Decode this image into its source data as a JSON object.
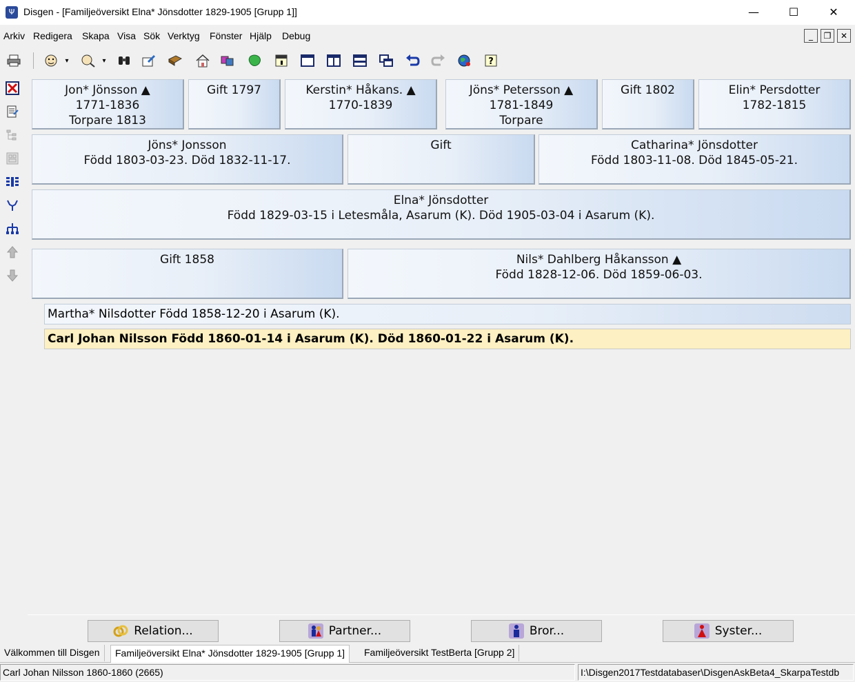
{
  "window": {
    "app_icon_glyph": "Ψ",
    "title": "Disgen - [Familjeöversikt Elna* Jönsdotter 1829-1905 [Grupp 1]]",
    "minimize": "—",
    "maximize": "☐",
    "close": "✕"
  },
  "menu": {
    "items": [
      "Arkiv",
      "Redigera",
      "Skapa",
      "Visa",
      "Sök",
      "Verktyg",
      "Fönster",
      "Hjälp",
      "Debug"
    ],
    "mdi_min": "_",
    "mdi_restore": "❐",
    "mdi_close": "✕"
  },
  "toolbar": {
    "icons": [
      "printer-icon",
      "person-icon",
      "person-search-icon",
      "binoculars-icon",
      "edit-icon",
      "book-icon",
      "home-icon",
      "dice-icon",
      "map-icon",
      "calendar-icon",
      "window-single-icon",
      "window-split-vertical-icon",
      "window-split-horizontal-icon",
      "window-cascade-icon",
      "undo-icon",
      "redo-icon",
      "globe-icon",
      "help-icon"
    ]
  },
  "sidebar": {
    "icons": [
      "delete-icon",
      "note-icon",
      "tree-icon",
      "tree-grid-icon",
      "columns-icon",
      "ancestors-icon",
      "descendants-icon",
      "move-up-icon",
      "move-down-icon"
    ]
  },
  "grandparents": [
    {
      "line1": "Jon* Jönsson ▲",
      "line2": "1771-1836",
      "line3": "Torpare  1813"
    },
    {
      "line1": "Gift 1797",
      "line2": "",
      "line3": ""
    },
    {
      "line1": "Kerstin* Håkans. ▲",
      "line2": "1770-1839",
      "line3": ""
    },
    {
      "line1": "Jöns* Petersson ▲",
      "line2": "1781-1849",
      "line3": "Torpare"
    },
    {
      "line1": "Gift 1802",
      "line2": "",
      "line3": ""
    },
    {
      "line1": "Elin* Persdotter",
      "line2": "1782-1815",
      "line3": ""
    }
  ],
  "parents": {
    "father": {
      "name": "Jöns* Jonsson",
      "info": "Född 1803-03-23. Död 1832-11-17."
    },
    "marriage": {
      "label": "Gift"
    },
    "mother": {
      "name": "Catharina* Jönsdotter",
      "info": "Född 1803-11-08. Död 1845-05-21."
    }
  },
  "main_person": {
    "name": "Elna* Jönsdotter",
    "info": "Född 1829-03-15 i Letesmåla, Asarum (K). Död 1905-03-04 i Asarum (K)."
  },
  "spouse": {
    "marriage": {
      "label": "Gift 1858"
    },
    "partner": {
      "name": "Nils* Dahlberg Håkansson ▲",
      "info": "Född 1828-12-06. Död 1859-06-03."
    }
  },
  "children": [
    {
      "text": "Martha* Nilsdotter Född 1858-12-20 i Asarum (K).",
      "selected": false
    },
    {
      "text": "Carl Johan Nilsson Född 1860-01-14 i Asarum (K). Död 1860-01-22 i Asarum (K).",
      "selected": true
    }
  ],
  "actions": {
    "relation": "Relation...",
    "partner": "Partner...",
    "brother": "Bror...",
    "sister": "Syster..."
  },
  "tabs": [
    "Välkommen till Disgen",
    "Familjeöversikt Elna* Jönsdotter 1829-1905 [Grupp 1]",
    "Familjeöversikt TestBerta    [Grupp 2]"
  ],
  "status": {
    "left": "Carl Johan Nilsson 1860-1860 (2665)",
    "right": "I:\\Disgen2017Testdatabaser\\DisgenAskBeta4_SkarpaTestdb"
  },
  "colors": {
    "selected_row": "#fdf0c2",
    "card_gradient_end": "#c9daf0"
  }
}
